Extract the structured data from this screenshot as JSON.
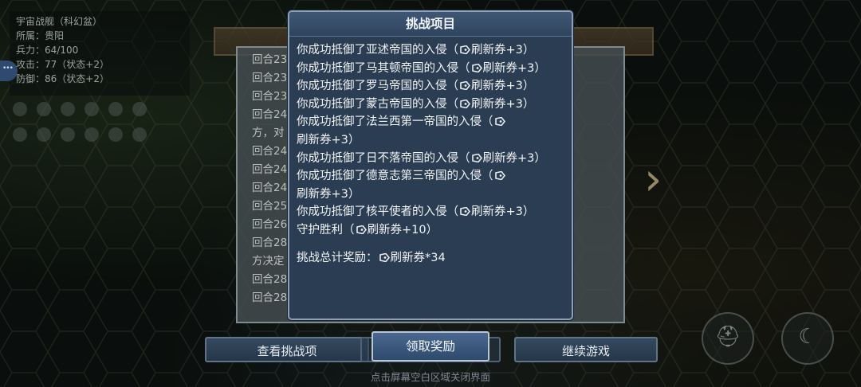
{
  "background": {
    "city_info": [
      "宇宙战舰（科幻盆）",
      "所属：贵阳",
      "兵力：64/100",
      "攻击：77（状态+2）",
      "防御：86（状态+2）"
    ],
    "log_lines": [
      "回合23",
      "回合23",
      "回合23",
      "回合24",
      "方，对",
      "回合24",
      "回合24",
      "回合24",
      "回合25",
      "回合26",
      "回合28",
      "方决定",
      "回合28",
      "回合28"
    ]
  },
  "modal": {
    "title": "挑战项目",
    "entries": [
      {
        "text": "你成功抵御了亚述帝国的入侵（",
        "reward": "刷新券+3）"
      },
      {
        "text": "你成功抵御了马其顿帝国的入侵（",
        "reward": "刷新券+3）"
      },
      {
        "text": "你成功抵御了罗马帝国的入侵（",
        "reward": "刷新券+3）"
      },
      {
        "text": "你成功抵御了蒙古帝国的入侵（",
        "reward": "刷新券+3）"
      },
      {
        "text": "你成功抵御了法兰西第一帝国的入侵（",
        "reward": "刷新券+3）"
      },
      {
        "text": "你成功抵御了日不落帝国的入侵（",
        "reward": "刷新券+3）"
      },
      {
        "text": "你成功抵御了德意志第三帝国的入侵（",
        "reward": "刷新券+3）"
      },
      {
        "text": "你成功抵御了核平使者的入侵（",
        "reward": "刷新券+3）"
      },
      {
        "text": "守护胜利（",
        "reward": "刷新券+10）"
      }
    ],
    "total_label": "挑战总计奖励：",
    "total_reward": "刷新券*34"
  },
  "buttons": {
    "view": "查看挑战项",
    "claim": "领取奖励",
    "continue": "继续游戏"
  },
  "hint": "点击屏幕空白区域关闭界面",
  "icons": {
    "ticket": "refresh-ticket-icon",
    "next": "chevron-right-icon",
    "helmet": "helmet-icon",
    "sleep": "moon-sleep-icon"
  }
}
